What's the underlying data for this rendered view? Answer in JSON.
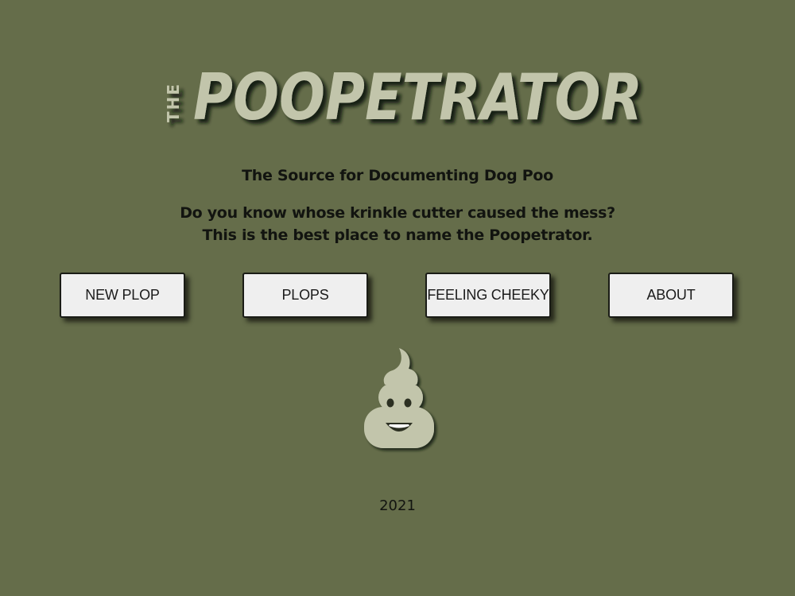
{
  "header": {
    "logo_prefix": "THE",
    "logo_title": "POOPETRATOR"
  },
  "tagline": {
    "source": "The Source for Documenting Dog Poo",
    "question_line1": "Do you know whose krinkle cutter caused the mess?",
    "question_line2": "This is the best place to name the Poopetrator."
  },
  "nav": {
    "new_plop": "NEW PLOP",
    "plops": "PLOPS",
    "feeling_cheeky": "FEELING CHEEKY",
    "about": "ABOUT"
  },
  "icons": {
    "mascot": "poo-emoji-icon"
  },
  "colors": {
    "background": "#656d4a",
    "logo_fill": "#c2c5ab",
    "button_bg": "#efefef",
    "text_dark": "#121410"
  },
  "footer": {
    "year": "2021"
  }
}
